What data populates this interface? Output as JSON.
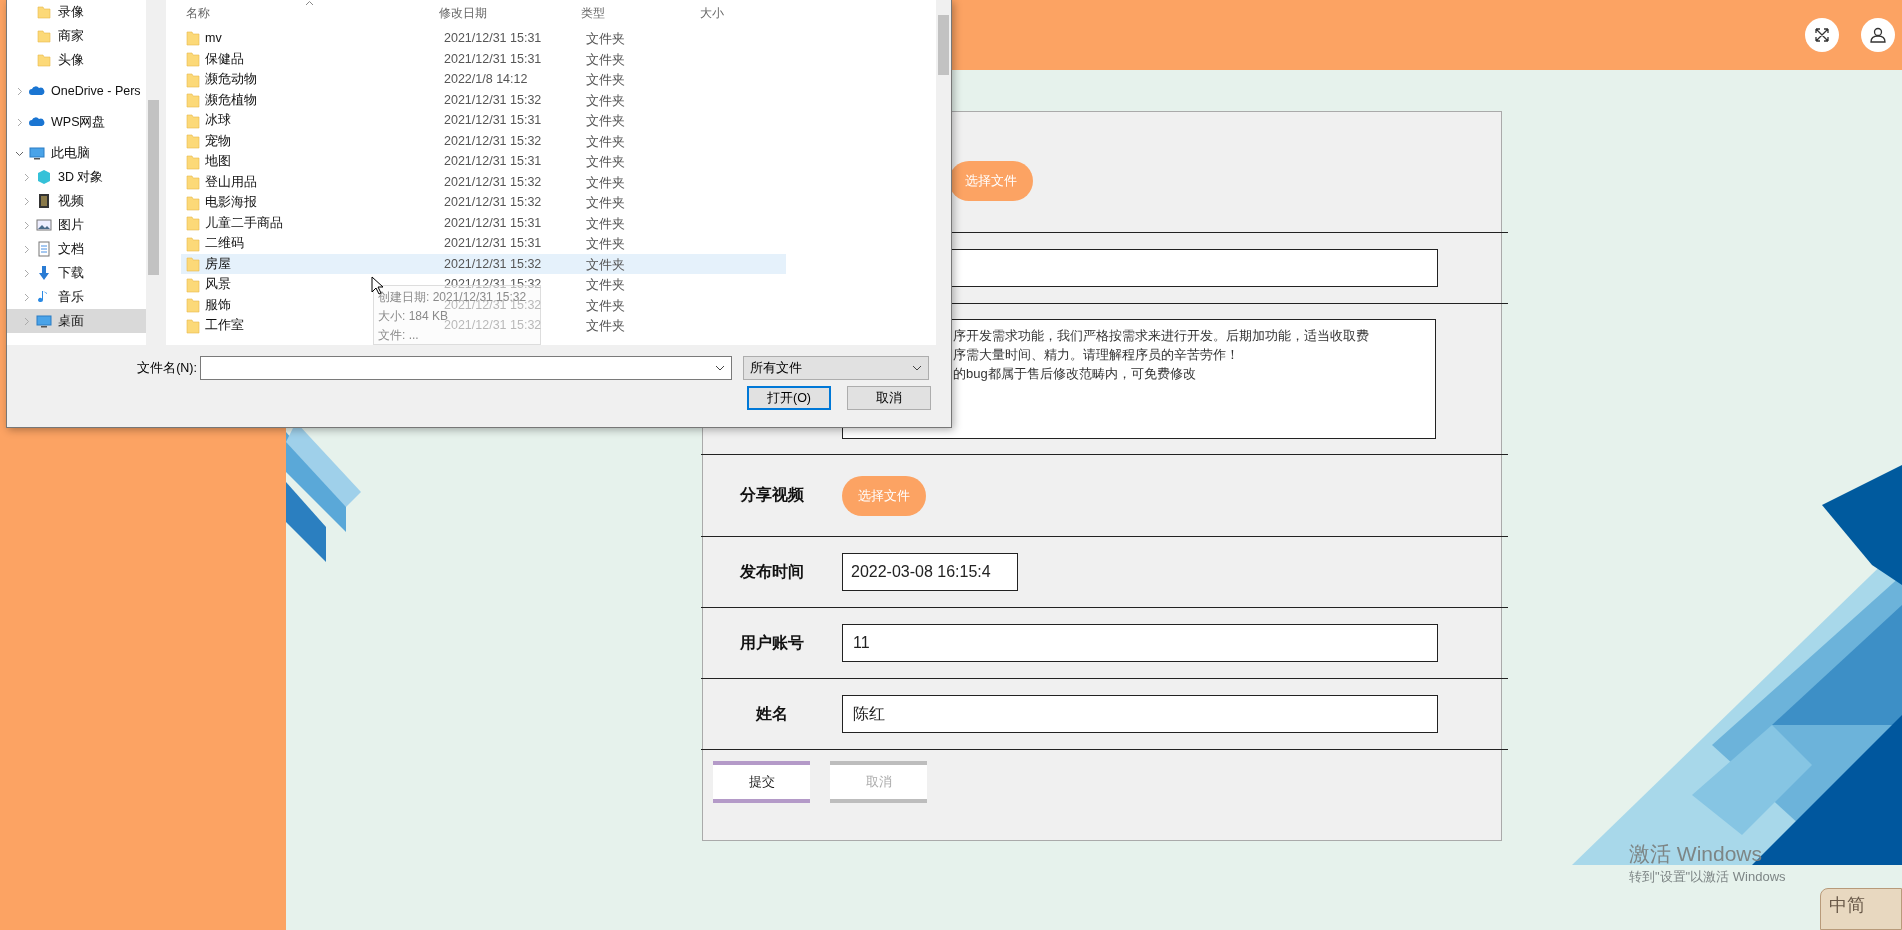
{
  "dialog": {
    "nav": [
      {
        "label": "录像",
        "kind": "folder",
        "selected": false
      },
      {
        "label": "商家",
        "kind": "folder",
        "selected": false
      },
      {
        "label": "头像",
        "kind": "folder",
        "selected": false
      },
      {
        "label": "OneDrive - Pers",
        "kind": "cloud",
        "expanded": false,
        "selected": false
      },
      {
        "label": "WPS网盘",
        "kind": "cloud",
        "expanded": false,
        "selected": false
      },
      {
        "label": "此电脑",
        "kind": "pc",
        "expanded": true,
        "selected": false,
        "children": [
          {
            "label": "3D 对象",
            "kind": "cube",
            "expanded": false,
            "selected": false
          },
          {
            "label": "视频",
            "kind": "film",
            "expanded": false,
            "selected": false
          },
          {
            "label": "图片",
            "kind": "picture",
            "expanded": false,
            "selected": false
          },
          {
            "label": "文档",
            "kind": "doc",
            "expanded": false,
            "selected": false
          },
          {
            "label": "下载",
            "kind": "download",
            "expanded": false,
            "selected": false
          },
          {
            "label": "音乐",
            "kind": "music",
            "expanded": false,
            "selected": false
          },
          {
            "label": "桌面",
            "kind": "pc",
            "expanded": false,
            "selected": true
          }
        ]
      }
    ],
    "columns": [
      "名称",
      "修改日期",
      "类型",
      "大小"
    ],
    "files": [
      {
        "name": "mv",
        "date": "2021/12/31 15:31",
        "type": "文件夹",
        "selected": false
      },
      {
        "name": "保健品",
        "date": "2021/12/31 15:31",
        "type": "文件夹",
        "selected": false
      },
      {
        "name": "濒危动物",
        "date": "2022/1/8 14:12",
        "type": "文件夹",
        "selected": false
      },
      {
        "name": "濒危植物",
        "date": "2021/12/31 15:32",
        "type": "文件夹",
        "selected": false
      },
      {
        "name": "冰球",
        "date": "2021/12/31 15:31",
        "type": "文件夹",
        "selected": false
      },
      {
        "name": "宠物",
        "date": "2021/12/31 15:32",
        "type": "文件夹",
        "selected": false
      },
      {
        "name": "地图",
        "date": "2021/12/31 15:31",
        "type": "文件夹",
        "selected": false
      },
      {
        "name": "登山用品",
        "date": "2021/12/31 15:32",
        "type": "文件夹",
        "selected": false
      },
      {
        "name": "电影海报",
        "date": "2021/12/31 15:32",
        "type": "文件夹",
        "selected": false
      },
      {
        "name": "儿童二手商品",
        "date": "2021/12/31 15:31",
        "type": "文件夹",
        "selected": false
      },
      {
        "name": "二维码",
        "date": "2021/12/31 15:31",
        "type": "文件夹",
        "selected": false
      },
      {
        "name": "房屋",
        "date": "2021/12/31 15:32",
        "type": "文件夹",
        "selected": true
      },
      {
        "name": "风景",
        "date": "2021/12/31 15:32",
        "type": "文件夹",
        "selected": false
      },
      {
        "name": "服饰",
        "date": "2021/12/31 15:32",
        "type": "文件夹",
        "selected": false
      },
      {
        "name": "工作室",
        "date": "2021/12/31 15:32",
        "type": "文件夹",
        "selected": false
      }
    ],
    "tooltip": [
      "创建日期: 2021/12/31 15:32",
      "大小: 184 KB",
      "文件: ..."
    ],
    "filename_label": "文件名(N):",
    "filter": "所有文件",
    "buttons": [
      {
        "label": "打开(O)",
        "kind": "default"
      },
      {
        "label": "取消",
        "kind": "normal"
      }
    ]
  },
  "form": {
    "rows": [
      {
        "kind": "upload",
        "button": "选择文件"
      },
      {
        "kind": "input"
      },
      {
        "kind": "textarea",
        "lines": [
          "序开发需求功能，我们严格按需求来进行开发。后期加功能，适当收取费",
          "序需大量时间、精力。请理解程序员的辛苦劳作！",
          "的bug都属于售后修改范畴内，可免费修改"
        ]
      },
      {
        "kind": "upload",
        "label": "分享视频",
        "button": "选择文件"
      },
      {
        "kind": "datetime",
        "label": "发布时间",
        "value": "2022-03-08 16:15:4"
      },
      {
        "kind": "input",
        "label": "用户账号",
        "value": "11"
      },
      {
        "kind": "input",
        "label": "姓名",
        "value": "陈红"
      }
    ],
    "buttons": [
      {
        "label": "提交",
        "kind": "primary"
      },
      {
        "label": "取消",
        "kind": "cancel"
      }
    ]
  },
  "watermark": {
    "title": "激活 Windows",
    "hint": "转到\"设置\"以激活 Windows"
  },
  "ime": "中简"
}
